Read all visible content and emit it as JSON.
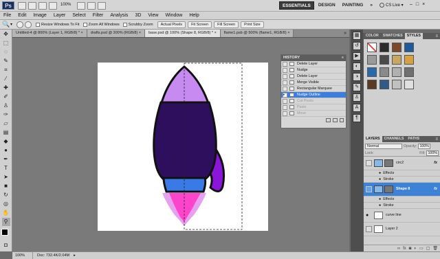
{
  "app": {
    "logo": "Ps",
    "zoom": "100%",
    "workspaces": [
      "ESSENTIALS",
      "DESIGN",
      "PAINTING"
    ],
    "more": "»",
    "cs_live": "CS Live ▾",
    "window_controls": [
      "–",
      "□",
      "×"
    ]
  },
  "menu": [
    "File",
    "Edit",
    "Image",
    "Layer",
    "Select",
    "Filter",
    "Analysis",
    "3D",
    "View",
    "Window",
    "Help"
  ],
  "options": {
    "checks": [
      "Resize Windows To Fit",
      "Zoom All Windows",
      "Scrubby Zoom"
    ],
    "buttons": [
      "Actual Pixels",
      "Fit Screen",
      "Fill Screen",
      "Print Size"
    ]
  },
  "tabs": [
    {
      "label": "Untitled-4 @ 800% (Layer 1, RGB/8) *",
      "active": false
    },
    {
      "label": "drafts.psd @ 300% (RGB/8)",
      "active": false
    },
    {
      "label": "base.psd @ 100% (Shape 8, RGB/8) *",
      "active": true
    },
    {
      "label": "flame1.psb @ 500% (flame1, RGB/8)",
      "active": false
    }
  ],
  "history": {
    "title": "HISTORY",
    "items": [
      {
        "label": "Delete Layer",
        "state": "normal"
      },
      {
        "label": "Nudge",
        "state": "normal"
      },
      {
        "label": "Delete Layer",
        "state": "normal"
      },
      {
        "label": "Merge Visible",
        "state": "normal"
      },
      {
        "label": "Rectangular Marquee",
        "state": "normal"
      },
      {
        "label": "Nudge Outline",
        "state": "selected"
      },
      {
        "label": "Cut Pixels",
        "state": "dim"
      },
      {
        "label": "Paste",
        "state": "dim"
      },
      {
        "label": "Move",
        "state": "dim"
      }
    ]
  },
  "styles_panel": {
    "tabs": [
      "COLOR",
      "SWATCHES",
      "STYLES"
    ],
    "active_tab": "STYLES",
    "swatch_colors": [
      "#e8e8e8",
      "#2b2b2b",
      "#7a4a2a",
      "#1e5a9a",
      "#9a9a9a",
      "#4a4a4a",
      "#c8a860",
      "#d8a040",
      "#2a6aaa",
      "#8a8a8a",
      "#b0b0b0",
      "#707070",
      "#5a3a22",
      "#305a88",
      "#c0c0c0",
      "#e0e0e0"
    ]
  },
  "layers_panel": {
    "tabs": [
      "LAYERS",
      "CHANNELS",
      "PATHS"
    ],
    "blend_mode": "Normal",
    "opacity_label": "Opacity:",
    "opacity": "100%",
    "lock_label": "Lock:",
    "fill_label": "Fill:",
    "fill": "100%",
    "layers": [
      {
        "name": "circ2",
        "fx": "fx",
        "selected": false,
        "effects": [
          "Effects",
          "Stroke"
        ]
      },
      {
        "name": "Shape 8",
        "fx": "fx",
        "selected": true,
        "effects": [
          "Effects",
          "Stroke"
        ]
      },
      {
        "name": "curve line",
        "fx": "",
        "selected": false,
        "effects": []
      },
      {
        "name": "Layer 2",
        "fx": "",
        "selected": false,
        "effects": []
      }
    ]
  },
  "status": {
    "zoom": "100%",
    "doc": "Doc: 732.4K/2.04M"
  },
  "colors": {
    "rocket_body": "#2e0f5e",
    "rocket_nose": "#c78af0",
    "rocket_band": "#3a7ae6",
    "rocket_fin": "#8a16d8",
    "flame_pink": "#ff44cc",
    "flame_light": "#e6a0f0"
  }
}
